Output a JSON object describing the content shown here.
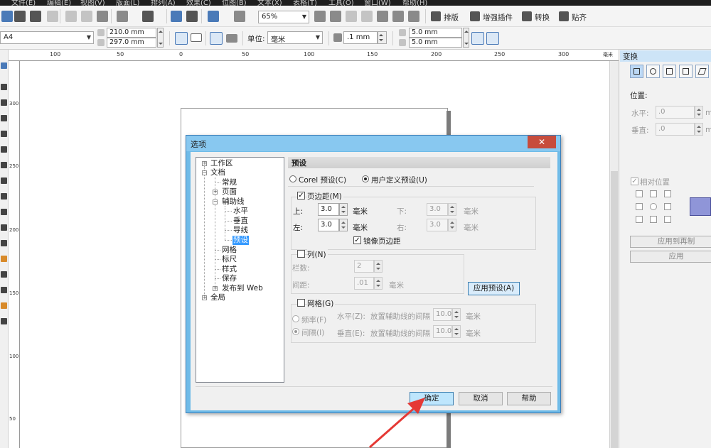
{
  "menubar": {
    "items": [
      "文件(E)",
      "编辑(E)",
      "视图(V)",
      "版面(L)",
      "排列(A)",
      "效果(C)",
      "位图(B)",
      "文本(X)",
      "表格(T)",
      "工具(O)",
      "窗口(W)",
      "帮助(H)"
    ]
  },
  "toolbar1": {
    "zoom": "65%",
    "buttons": {
      "arrange": "排版",
      "enhance": "增强插件",
      "convert": "转换",
      "paste": "贴齐"
    }
  },
  "toolbar2": {
    "paper_size": "A4",
    "width": "210.0 mm",
    "height": "297.0 mm",
    "unit_label": "单位:",
    "unit": "毫米",
    "nudge": ".1 mm",
    "dup_x": "5.0 mm",
    "dup_y": "5.0 mm"
  },
  "ruler": {
    "h_labels": [
      "100",
      "50",
      "0",
      "50",
      "100",
      "150",
      "200",
      "250",
      "300"
    ],
    "h_unit": "毫米",
    "v_labels": [
      "300",
      "250",
      "200",
      "150",
      "100",
      "50"
    ]
  },
  "transform_panel": {
    "title": "变换",
    "position": "位置:",
    "horizontal": "水平:",
    "vertical": "垂直:",
    "h_value": ".0",
    "v_value": ".0",
    "unit_clip": "m",
    "relative": "相对位置",
    "apply_copy": "应用到再制",
    "apply": "应用"
  },
  "dialog": {
    "title": "选项",
    "close": "✕",
    "tree": {
      "workspace": "工作区",
      "document": "文档",
      "general": "常规",
      "page": "页面",
      "guidelines": "辅助线",
      "horizontal": "水平",
      "vertical": "垂直",
      "guides": "导线",
      "presets": "预设",
      "grid": "网格",
      "rulers": "标尺",
      "styles": "样式",
      "save": "保存",
      "publish": "发布到 Web",
      "global": "全局"
    },
    "section_title": "预设",
    "corel_preset": "Corel 预设(C)",
    "user_preset": "用户定义预设(U)",
    "margins": "页边距(M)",
    "top": "上:",
    "bottom": "下:",
    "left": "左:",
    "right": "右:",
    "top_val": "3.0",
    "bottom_val": "3.0",
    "left_val": "3.0",
    "right_val": "3.0",
    "mm": "毫米",
    "mirror": "镜像页边距",
    "columns": "列(N)",
    "col_count": "栏数:",
    "col_count_val": "2",
    "gutter": "间距:",
    "gutter_val": ".01",
    "apply_preset": "应用预设(A)",
    "grid": "网格(G)",
    "frequency": "频率(F)",
    "spacing": "间隔(I)",
    "grid_h": "水平(Z):",
    "grid_v": "垂直(E):",
    "grid_desc": "放置辅助线的间隔",
    "grid_h_val": "10.0",
    "grid_v_val": "10.0",
    "ok": "确定",
    "cancel": "取消",
    "help": "帮助"
  }
}
